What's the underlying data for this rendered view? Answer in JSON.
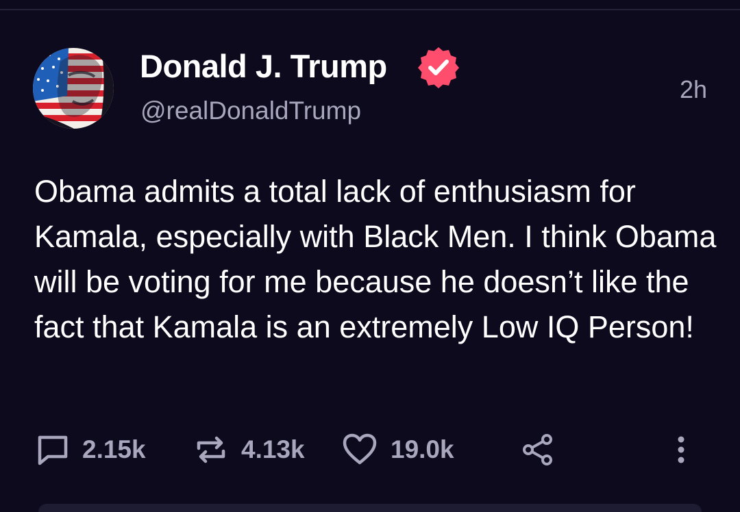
{
  "post": {
    "author": {
      "display_name": "Donald J. Trump",
      "handle": "@realDonaldTrump",
      "verified": true,
      "avatar_icon": "flag-portrait-avatar"
    },
    "timestamp": "2h",
    "body": "Obama admits a total lack of enthusiasm for Kamala, especially with Black Men. I think Obama will be voting for me because he doesn’t like the fact that Kamala is an extremely Low IQ Person!",
    "actions": {
      "replies": "2.15k",
      "reposts": "4.13k",
      "likes": "19.0k"
    },
    "icons": {
      "reply": "speech-bubble-icon",
      "repost": "repost-arrows-icon",
      "like": "heart-outline-icon",
      "share": "share-nodes-icon",
      "more": "vertical-ellipsis-icon",
      "verified": "verified-badge-icon"
    }
  },
  "colors": {
    "background": "#0c0a1c",
    "text_primary": "#ffffff",
    "text_secondary": "#a9a7bd",
    "verified_badge": "#ff4d6d"
  }
}
